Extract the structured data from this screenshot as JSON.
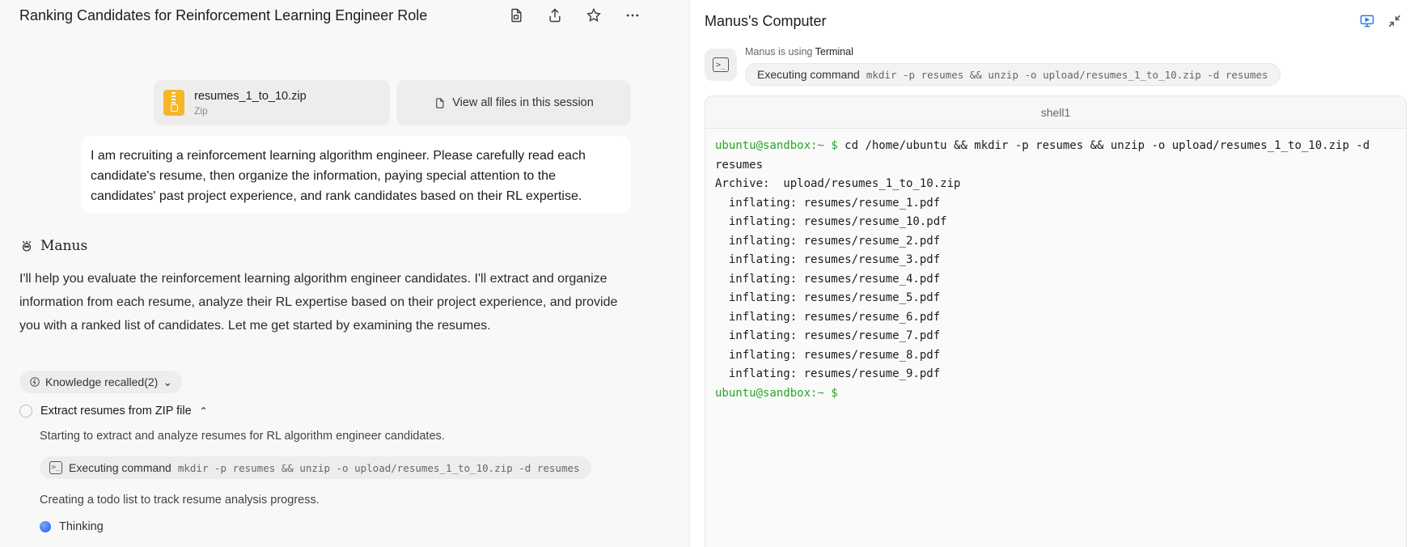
{
  "header": {
    "title": "Ranking Candidates for Reinforcement Learning Engineer Role",
    "actions": [
      "file-icon",
      "share-icon",
      "star-icon",
      "more-icon"
    ]
  },
  "attachments": {
    "file_name": "resumes_1_to_10.zip",
    "file_type": "Zip",
    "view_all_label": "View all files in this session"
  },
  "user_message": "I am recruiting a reinforcement learning algorithm engineer. Please carefully read each candidate's resume, then organize the information, paying special attention to the candidates' past project experience, and rank candidates based on their RL expertise.",
  "assistant": {
    "name": "Manus",
    "message": "I'll help you evaluate the reinforcement learning algorithm engineer candidates. I'll extract and organize information from each resume, analyze their RL expertise based on their project experience, and provide you with a ranked list of candidates. Let me get started by examining the resumes.",
    "knowledge_label": "Knowledge recalled(2)",
    "task_title": "Extract resumes from ZIP file",
    "step_1": "Starting to extract and analyze resumes for RL algorithm engineer candidates.",
    "command_label": "Executing command",
    "command": "mkdir -p resumes && unzip -o upload/resumes_1_to_10.zip -d resumes",
    "step_2": "Creating a todo list to track resume analysis progress.",
    "thinking_label": "Thinking"
  },
  "computer": {
    "title": "Manus's Computer",
    "using_prefix": "Manus is using",
    "using_tool": "Terminal",
    "command_label": "Executing command",
    "command": "mkdir -p resumes && unzip -o upload/resumes_1_to_10.zip -d resumes",
    "terminal_tab": "shell1",
    "prompt": "ubuntu@sandbox:~ $",
    "lines": [
      "cd /home/ubuntu && mkdir -p resumes && unzip -o upload/resumes_1_to_10.zip -d",
      "resumes",
      "Archive:  upload/resumes_1_to_10.zip",
      "  inflating: resumes/resume_1.pdf",
      "  inflating: resumes/resume_10.pdf",
      "  inflating: resumes/resume_2.pdf",
      "  inflating: resumes/resume_3.pdf",
      "  inflating: resumes/resume_4.pdf",
      "  inflating: resumes/resume_5.pdf",
      "  inflating: resumes/resume_6.pdf",
      "  inflating: resumes/resume_7.pdf",
      "  inflating: resumes/resume_8.pdf",
      "  inflating: resumes/resume_9.pdf"
    ]
  }
}
